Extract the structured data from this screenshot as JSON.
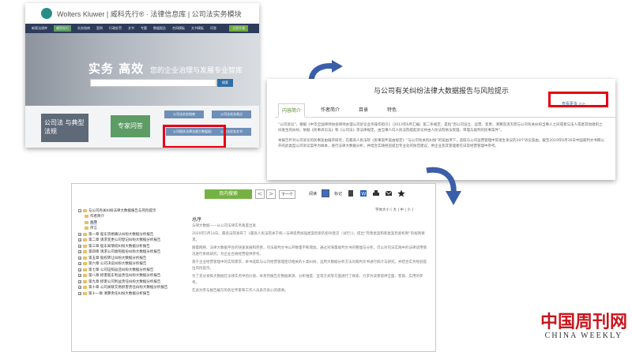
{
  "screen1": {
    "brand": "Wolters Kluwer | 威科先行® · 法律信息库 | 公司法实务模块",
    "nav_items": [
      "新版法规库",
      "威科先行",
      "实务指南",
      "案例",
      "行政处罚",
      "文书",
      "专题",
      "实务指南",
      "数据报告",
      "合同模板",
      "文书模板",
      "问答",
      "企业数据"
    ],
    "nav_cta": "立即开通",
    "hero_title": "实务 高效",
    "hero_subtitle": "您的企业治理与发展专业智库",
    "search_button": "搜索",
    "tile_dark_text": "公司法 与典型 法规",
    "tile_green": "专家问答",
    "tiles": [
      "公司法实务指南",
      "公司法实务观点",
      "公司相关法律法规大数据报告",
      "公司法实务文书"
    ]
  },
  "screen2": {
    "heading": "与公司有关纠纷法律大数据报告与风险提示",
    "tabs": [
      "内容简介",
      "作者简介",
      "目录",
      "特色"
    ],
    "more_link": "查看更多 >>",
    "para1": "“公司诉讼”，根据《中华全国律师协会律师办理公司诉讼业务操作指引》（2013年6月汇编）第二条规定，是指“因公司设立、运营、变更、清算及消灭而与公司有关纠纷当事人之间或者与法人或者其他组织之间发生的纠纷，依据《民事诉讼法》和《公司法》等法律规定，由当事人向人民法院提起诉讼并由人民法院依法受理、审理与裁判的民事案件”。",
    "para2": "本报告针对公司诉讼的民事案由展开研究，在最高人民法院《民事案件案由规定》“与公司有关的纠纷”的案由项下，选取与公司运营管理中常发生争议的10个诉讼案由，截至2019年6月30日中国裁判文书网公开的此类型公司诉讼案件为样本，进行法律大数据分析，并结合实践经验提出专业化的防范建议，供企业及其管理者在日常经营管理中参考。"
  },
  "screen3": {
    "search_button": "页内搜索",
    "prev_symbol": "<",
    "next_symbol": ">",
    "next_item": "下一个",
    "tools": [
      "阅读",
      "标记"
    ],
    "tree": [
      "与公司有关纠纷法律大数据报告与风险提示",
      "作者简介",
      "总序",
      "序言",
      "第一章 股东资格确认纠纷大数据分析报告",
      "第二章 请求变更公司登记纠纷大数据分析报告",
      "第三章 股东知情权纠纷大数据分析报告",
      "第四章 请求公司收购股份纠纷大数据分析报告",
      "第五章 股权转让纠纷大数据分析报告",
      "第六章 公司决议纠纷大数据分析报告",
      "第七章 公司证照返还纠纷大数据分析报告",
      "第八章 损害股东利益责任纠纷大数据分析报告",
      "第九章 损害公司利益责任纠纷大数据分析报告",
      "第十章 公司关联交易损害责任纠纷大数据分析报告",
      "第十一章 清算责任纠纷大数据分析报告"
    ],
    "font_size_label": "字体大小 [ 大 | 中 | 小 ]",
    "doc_title": "总序",
    "doc_paragraphs": [
      "法律大数据——从公司法律实务角度出发",
      "2020年5月14日，最高法院发布了《最高人民法院关于统一法律适用加强类案检索的指导意见（试行）》，提出“完善类案和新类案检索机制”的规则要求。",
      "随着网络、法律大数据平台的快速发展和完善，司法裁判文书公开数量不断增加，通过对海量裁判文书的整理与分析，可以对司法实践中的法律适用情况进行系统研究，为企业合规经营提供参考。",
      "基于企业经营管理中的实际需求，本书选取与公司经营管理密切相关的十类纠纷，运用大数据分析方法对裁判文书进行统计与研究，并结合实务经验提出风险提示。",
      "为了充分发挥大数据在法律实务中的价值，本系列报告在数据来源、分析维度、呈现方式等方面进行了探索，力求为读者提供全面、客观、实用的参考。",
      "在此对参与报告编写的各位专家和工作人员表示衷心的感谢。"
    ]
  },
  "watermark": {
    "cn": "中国周刊网",
    "en": "CHINA WEEKLY"
  },
  "colors": {
    "nav_bg": "#2e3c5b",
    "highlight_red": "#e60012",
    "green_button": "#75b243",
    "arrow_blue": "#3b5ea8"
  }
}
